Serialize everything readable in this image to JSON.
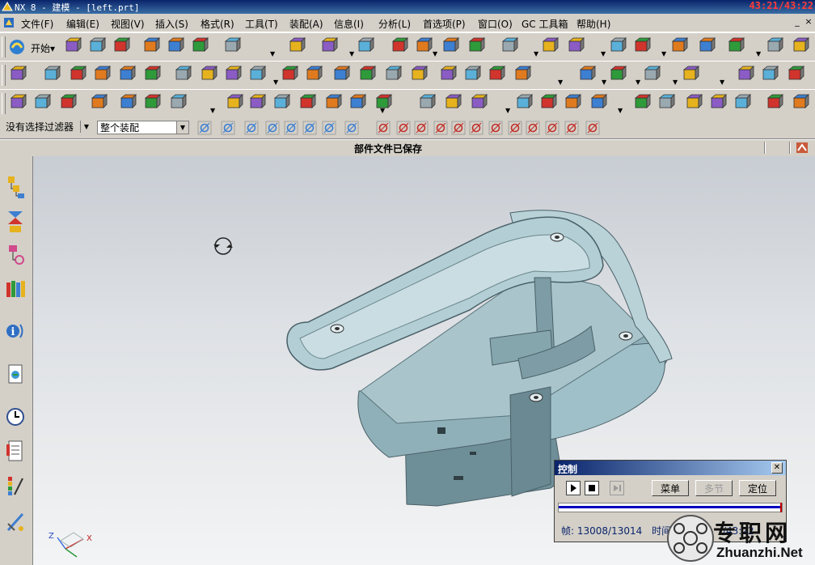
{
  "window": {
    "title": "NX 8 - 建模 - [left.prt]",
    "clock": "43:21/43:22"
  },
  "menubar": {
    "items": [
      "文件(F)",
      "编辑(E)",
      "视图(V)",
      "插入(S)",
      "格式(R)",
      "工具(T)",
      "装配(A)",
      "信息(I)",
      "分析(L)",
      "首选项(P)",
      "窗口(O)",
      "GC 工具箱",
      "帮助(H)"
    ],
    "window_controls": [
      "_",
      "×"
    ]
  },
  "toolbar": {
    "start_label": "开始▾"
  },
  "selection_bar": {
    "filter_value": "没有选择过滤器",
    "scope_value": "整个装配"
  },
  "cue_line": {
    "status": "部件文件已保存"
  },
  "control_dialog": {
    "title": "控制",
    "buttons": {
      "menu": "菜单",
      "multi_section": "多节",
      "locate": "定位"
    },
    "frame_label": "帧: 13008/13014",
    "time_label": "时间",
    "time_value": "/43:22",
    "progress": 0.9995
  },
  "triad": {
    "z_label": "Z",
    "x_label": "X"
  },
  "watermark": {
    "cn": "专职网",
    "en": "Zhuanzhi.Net"
  },
  "colors": {
    "title_bar": "#0a246a",
    "model": "#7f9fa8",
    "clock": "#ff3b3b",
    "progress": "#0000c0"
  }
}
